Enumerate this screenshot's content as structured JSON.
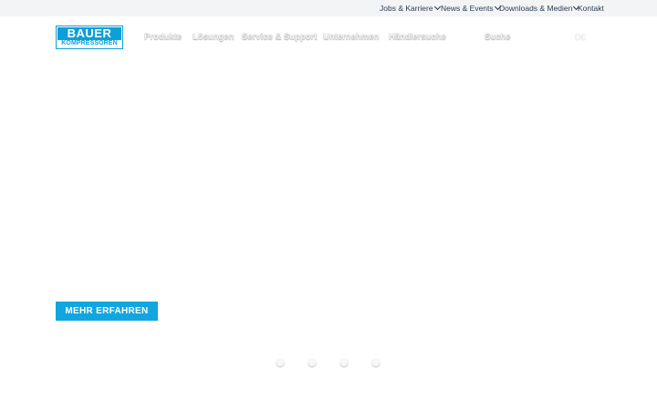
{
  "topbar": {
    "items": [
      {
        "label": "Jobs & Karriere",
        "has_dropdown": true
      },
      {
        "label": "News & Events",
        "has_dropdown": true
      },
      {
        "label": "Downloads & Medien",
        "has_dropdown": true
      },
      {
        "label": "Kontakt",
        "has_dropdown": false
      }
    ]
  },
  "logo": {
    "line1": "BAUER",
    "line2": "KOMPRESSOREN",
    "color": "#0f9fd8"
  },
  "nav": {
    "items": [
      {
        "label": "Produkte"
      },
      {
        "label": "Lösungen"
      },
      {
        "label": "Service & Support"
      },
      {
        "label": "Unternehmen"
      },
      {
        "label": "Händlersuche"
      }
    ],
    "search_label": "Suche",
    "language": "DE"
  },
  "hero": {
    "cta_label": "MEHR ERFAHREN",
    "cta_color": "#11a6df"
  },
  "slider": {
    "slide_count": 4
  }
}
